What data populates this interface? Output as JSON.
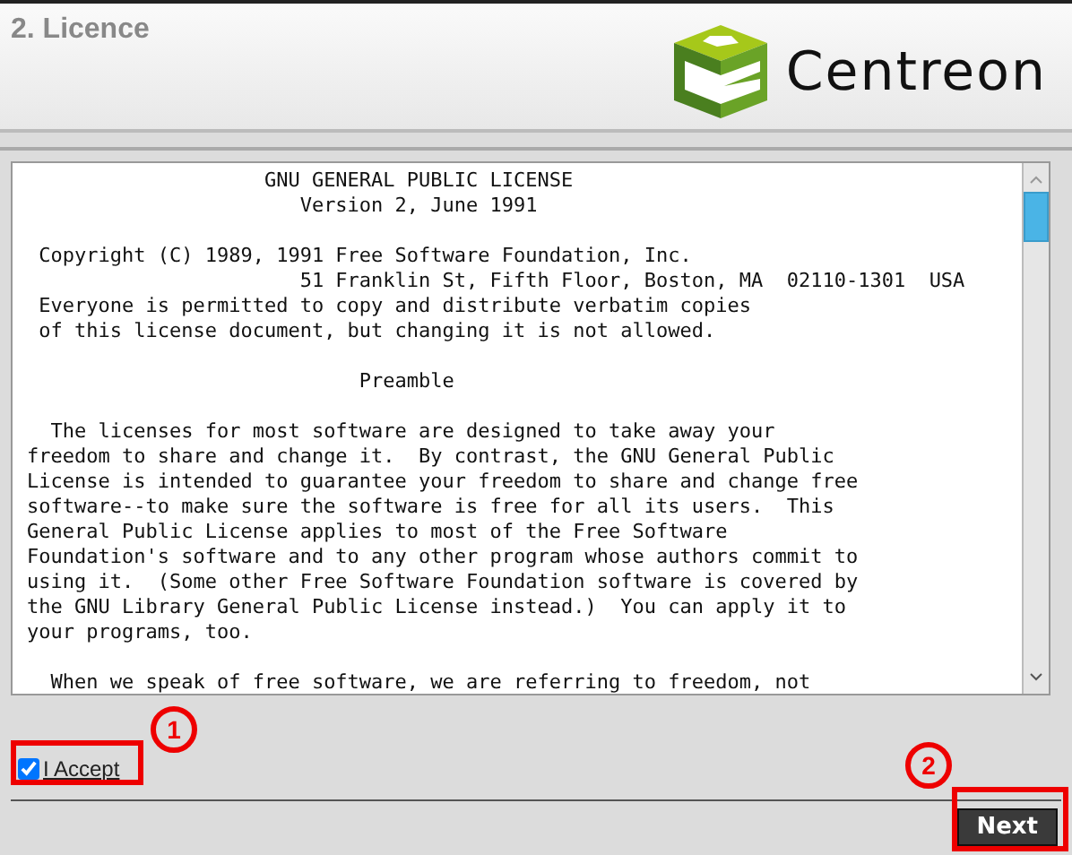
{
  "header": {
    "title": "2. Licence",
    "logo_text": "Centreon"
  },
  "licence_text": "                    GNU GENERAL PUBLIC LICENSE\n                       Version 2, June 1991\n\n Copyright (C) 1989, 1991 Free Software Foundation, Inc.\n                       51 Franklin St, Fifth Floor, Boston, MA  02110-1301  USA\n Everyone is permitted to copy and distribute verbatim copies\n of this license document, but changing it is not allowed.\n\n                            Preamble\n\n  The licenses for most software are designed to take away your\nfreedom to share and change it.  By contrast, the GNU General Public\nLicense is intended to guarantee your freedom to share and change free\nsoftware--to make sure the software is free for all its users.  This\nGeneral Public License applies to most of the Free Software\nFoundation's software and to any other program whose authors commit to\nusing it.  (Some other Free Software Foundation software is covered by\nthe GNU Library General Public License instead.)  You can apply it to\nyour programs, too.\n\n  When we speak of free software, we are referring to freedom, not",
  "accept": {
    "label": "I Accept",
    "checked": true
  },
  "next_button": {
    "label": "Next"
  },
  "annotations": [
    {
      "number": "1"
    },
    {
      "number": "2"
    }
  ]
}
